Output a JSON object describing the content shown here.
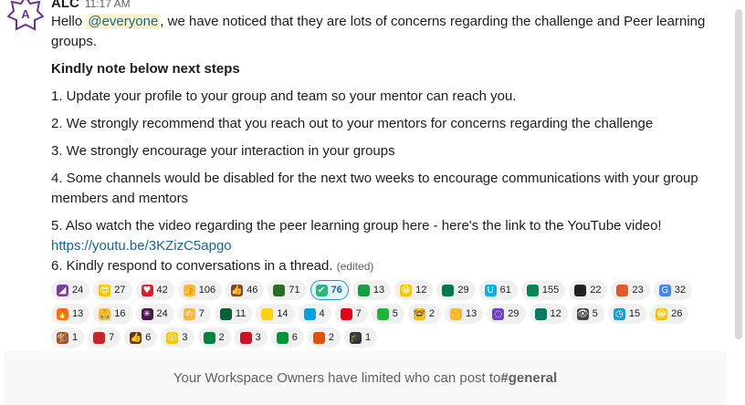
{
  "message": {
    "author": "ALC",
    "timestamp": "11:17 AM",
    "greeting_start": "Hello ",
    "mention": "@everyone",
    "greeting_end": ", we have noticed that they are lots of concerns regarding the challenge and Peer learning groups.",
    "heading": "Kindly note below next steps",
    "step1": "1. Update your profile to your group and team so your mentor can reach you.",
    "step2": "2. We strongly recommend that you reach out to your mentors for concerns regarding the challenge",
    "step3": "3. We strongly encourage your interaction in your groups",
    "step4": "4. Some channels would be disabled for the next two weeks to encourage communications with your group members and mentors",
    "step5": "5. Also watch the video regarding the peer learning group here - here's the link to the YouTube video!",
    "link": "https://youtu.be/3KZizC5apgo",
    "step6": "6. Kindly respond to conversations in a thread.",
    "edited": "(edited)"
  },
  "reactions": [
    {
      "icon": "party-icon",
      "glyph": "◢",
      "color": "#7a3e9d",
      "count": "24"
    },
    {
      "icon": "sunglasses-face-icon",
      "glyph": "😎",
      "color": "#f5c400",
      "count": "27"
    },
    {
      "icon": "red-heart-icon",
      "glyph": "♥",
      "color": "#d81e2c",
      "count": "42"
    },
    {
      "icon": "thumbs-up-icon",
      "glyph": "👍",
      "color": "#f6b93b",
      "count": "106"
    },
    {
      "icon": "thumbs-up-dark-icon",
      "glyph": "👍",
      "color": "#7b4a2a",
      "count": "46"
    },
    {
      "icon": "flag-kenya-icon",
      "glyph": "",
      "color": "#2a6b2a",
      "count": "71"
    },
    {
      "icon": "check-mark-icon",
      "glyph": "✔",
      "color": "#2eb67d",
      "count": "76",
      "active": true
    },
    {
      "icon": "flag-ethiopia-icon",
      "glyph": "",
      "color": "#1a9b3f",
      "count": "13"
    },
    {
      "icon": "grinning-face-icon",
      "glyph": "😁",
      "color": "#f5c400",
      "count": "12"
    },
    {
      "icon": "flag-south-africa-icon",
      "glyph": "",
      "color": "#007a4d",
      "count": "29"
    },
    {
      "icon": "udacity-icon",
      "glyph": "U",
      "color": "#02b3e4",
      "count": "61"
    },
    {
      "icon": "flag-nigeria-icon",
      "glyph": "",
      "color": "#008751",
      "count": "155"
    },
    {
      "icon": "flag-uganda-icon",
      "glyph": "",
      "color": "#222222",
      "count": "22"
    },
    {
      "icon": "cartoon-icon",
      "glyph": "",
      "color": "#e05a2b",
      "count": "23"
    },
    {
      "icon": "google-icon",
      "glyph": "G",
      "color": "#4285f4",
      "count": "32"
    },
    {
      "icon": "fire-icon",
      "glyph": "🔥",
      "color": "#f97316",
      "count": "13"
    },
    {
      "icon": "folded-hands-icon",
      "glyph": "🙏",
      "color": "#f6b93b",
      "count": "16"
    },
    {
      "icon": "slack-icon",
      "glyph": "✳",
      "color": "#4a154b",
      "count": "24"
    },
    {
      "icon": "writing-hand-icon",
      "glyph": "✍",
      "color": "#f6b93b",
      "count": "7"
    },
    {
      "icon": "flag-algeria-icon",
      "glyph": "",
      "color": "#006233",
      "count": "11"
    },
    {
      "icon": "flag-ghana-icon",
      "glyph": "",
      "color": "#fcd116",
      "count": "14"
    },
    {
      "icon": "flag-rwanda-icon",
      "glyph": "",
      "color": "#00a1de",
      "count": "4"
    },
    {
      "icon": "flag-tunisia-icon",
      "glyph": "",
      "color": "#e70013",
      "count": "7"
    },
    {
      "icon": "flag-tanzania-icon",
      "glyph": "",
      "color": "#1eb53a",
      "count": "5"
    },
    {
      "icon": "nerd-face-icon",
      "glyph": "🤓",
      "color": "#f5c400",
      "count": "2"
    },
    {
      "icon": "person-raising-hands-icon",
      "glyph": "🙌",
      "color": "#f6b93b",
      "count": "13"
    },
    {
      "icon": "loading-circle-icon",
      "glyph": "◌",
      "color": "#6f42c1",
      "count": "29"
    },
    {
      "icon": "flag-cameroon-icon",
      "glyph": "",
      "color": "#007a5e",
      "count": "12"
    },
    {
      "icon": "eye-icon",
      "glyph": "👁",
      "color": "#444444",
      "count": "5"
    },
    {
      "icon": "blue-clock-icon",
      "glyph": "◷",
      "color": "#1d9bd1",
      "count": "15"
    },
    {
      "icon": "laughing-face-icon",
      "glyph": "😂",
      "color": "#f5c400",
      "count": "26"
    },
    {
      "icon": "monkey-icon",
      "glyph": "🐒",
      "color": "#a0522d",
      "count": "1"
    },
    {
      "icon": "flag-morocco-icon",
      "glyph": "",
      "color": "#c1272d",
      "count": "7"
    },
    {
      "icon": "thumbs-up-brown-icon",
      "glyph": "👍",
      "color": "#5a3a22",
      "count": "6"
    },
    {
      "icon": "astonished-face-icon",
      "glyph": "😮",
      "color": "#f5c400",
      "count": "3"
    },
    {
      "icon": "flag-senegal-icon",
      "glyph": "",
      "color": "#00853f",
      "count": "2"
    },
    {
      "icon": "flag-egypt-icon",
      "glyph": "",
      "color": "#ce1126",
      "count": "3"
    },
    {
      "icon": "flag-mozambique-icon",
      "glyph": "",
      "color": "#009739",
      "count": "6"
    },
    {
      "icon": "flag-niger-icon",
      "glyph": "",
      "color": "#e05206",
      "count": "2"
    },
    {
      "icon": "graduation-cap-icon",
      "glyph": "🎓",
      "color": "#333333",
      "count": "1"
    }
  ],
  "footer": {
    "text_before": "Your Workspace Owners have limited who can post to ",
    "channel": "#general"
  }
}
